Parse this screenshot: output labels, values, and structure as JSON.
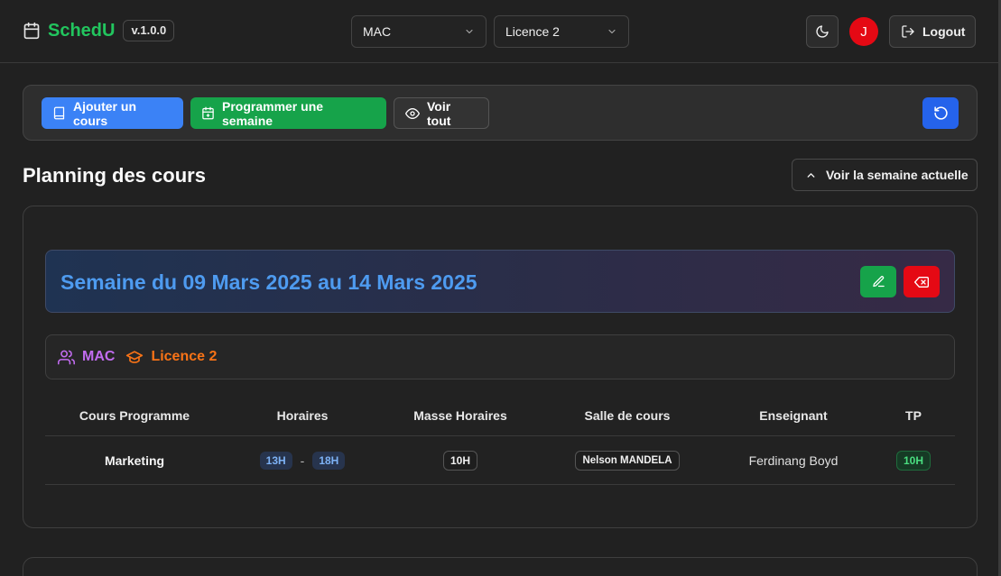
{
  "header": {
    "brand": "SchedU",
    "version": "v.1.0.0",
    "select_group": "MAC",
    "select_level": "Licence 2",
    "logout_label": "Logout",
    "avatar_letter": "J"
  },
  "toolbar": {
    "add_course": "Ajouter un cours",
    "schedule_week": "Programmer une semaine",
    "view_all": "Voir tout"
  },
  "page": {
    "title": "Planning des cours",
    "current_week_label": "Voir la semaine actuelle"
  },
  "week": {
    "title": "Semaine du 09 Mars 2025 au 14 Mars 2025",
    "group_tag": "MAC",
    "level_tag": "Licence 2"
  },
  "table": {
    "headers": [
      "Cours Programme",
      "Horaires",
      "Masse Horaires",
      "Salle de cours",
      "Enseignant",
      "TP"
    ],
    "rows": [
      {
        "course": "Marketing",
        "start": "13H",
        "end": "18H",
        "volume": "10H",
        "room": "Nelson MANDELA",
        "teacher": "Ferdinang Boyd",
        "tp": "10H"
      }
    ]
  },
  "colors": {
    "brand": "#22c55e",
    "primary": "#3b82f6",
    "success": "#16a34a",
    "danger": "#e50914",
    "group_tag": "#c26cf0",
    "level_tag": "#f97316",
    "week_title": "#4e9bf0"
  },
  "icons": {
    "brand": "calendar-icon",
    "theme": "moon-icon",
    "logout": "logout-icon",
    "add_course": "book-icon",
    "schedule_week": "calendar-plus-icon",
    "view_all": "eye-icon",
    "refresh": "refresh-icon",
    "current_week": "chevron-up-icon",
    "edit": "edit-icon",
    "delete": "delete-icon",
    "group": "users-icon",
    "level": "graduation-cap-icon"
  }
}
